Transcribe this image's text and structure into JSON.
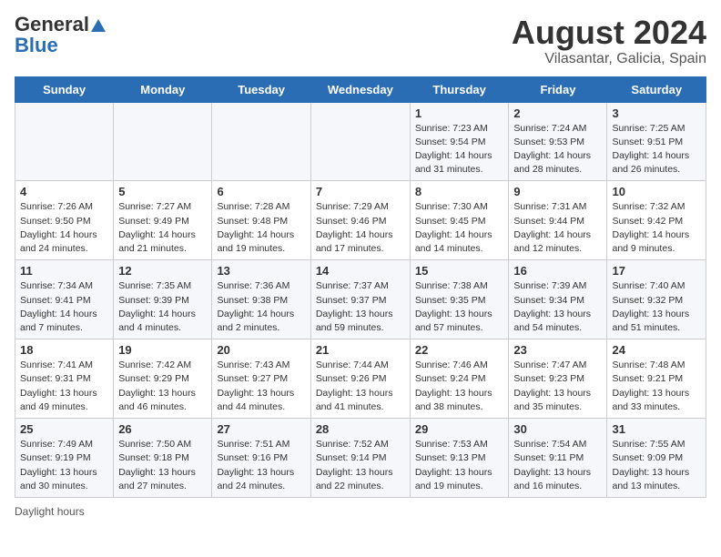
{
  "header": {
    "logo_general": "General",
    "logo_blue": "Blue",
    "title": "August 2024",
    "subtitle": "Vilasantar, Galicia, Spain"
  },
  "calendar": {
    "days_of_week": [
      "Sunday",
      "Monday",
      "Tuesday",
      "Wednesday",
      "Thursday",
      "Friday",
      "Saturday"
    ],
    "weeks": [
      [
        {
          "day": "",
          "detail": ""
        },
        {
          "day": "",
          "detail": ""
        },
        {
          "day": "",
          "detail": ""
        },
        {
          "day": "",
          "detail": ""
        },
        {
          "day": "1",
          "detail": "Sunrise: 7:23 AM\nSunset: 9:54 PM\nDaylight: 14 hours and 31 minutes."
        },
        {
          "day": "2",
          "detail": "Sunrise: 7:24 AM\nSunset: 9:53 PM\nDaylight: 14 hours and 28 minutes."
        },
        {
          "day": "3",
          "detail": "Sunrise: 7:25 AM\nSunset: 9:51 PM\nDaylight: 14 hours and 26 minutes."
        }
      ],
      [
        {
          "day": "4",
          "detail": "Sunrise: 7:26 AM\nSunset: 9:50 PM\nDaylight: 14 hours and 24 minutes."
        },
        {
          "day": "5",
          "detail": "Sunrise: 7:27 AM\nSunset: 9:49 PM\nDaylight: 14 hours and 21 minutes."
        },
        {
          "day": "6",
          "detail": "Sunrise: 7:28 AM\nSunset: 9:48 PM\nDaylight: 14 hours and 19 minutes."
        },
        {
          "day": "7",
          "detail": "Sunrise: 7:29 AM\nSunset: 9:46 PM\nDaylight: 14 hours and 17 minutes."
        },
        {
          "day": "8",
          "detail": "Sunrise: 7:30 AM\nSunset: 9:45 PM\nDaylight: 14 hours and 14 minutes."
        },
        {
          "day": "9",
          "detail": "Sunrise: 7:31 AM\nSunset: 9:44 PM\nDaylight: 14 hours and 12 minutes."
        },
        {
          "day": "10",
          "detail": "Sunrise: 7:32 AM\nSunset: 9:42 PM\nDaylight: 14 hours and 9 minutes."
        }
      ],
      [
        {
          "day": "11",
          "detail": "Sunrise: 7:34 AM\nSunset: 9:41 PM\nDaylight: 14 hours and 7 minutes."
        },
        {
          "day": "12",
          "detail": "Sunrise: 7:35 AM\nSunset: 9:39 PM\nDaylight: 14 hours and 4 minutes."
        },
        {
          "day": "13",
          "detail": "Sunrise: 7:36 AM\nSunset: 9:38 PM\nDaylight: 14 hours and 2 minutes."
        },
        {
          "day": "14",
          "detail": "Sunrise: 7:37 AM\nSunset: 9:37 PM\nDaylight: 13 hours and 59 minutes."
        },
        {
          "day": "15",
          "detail": "Sunrise: 7:38 AM\nSunset: 9:35 PM\nDaylight: 13 hours and 57 minutes."
        },
        {
          "day": "16",
          "detail": "Sunrise: 7:39 AM\nSunset: 9:34 PM\nDaylight: 13 hours and 54 minutes."
        },
        {
          "day": "17",
          "detail": "Sunrise: 7:40 AM\nSunset: 9:32 PM\nDaylight: 13 hours and 51 minutes."
        }
      ],
      [
        {
          "day": "18",
          "detail": "Sunrise: 7:41 AM\nSunset: 9:31 PM\nDaylight: 13 hours and 49 minutes."
        },
        {
          "day": "19",
          "detail": "Sunrise: 7:42 AM\nSunset: 9:29 PM\nDaylight: 13 hours and 46 minutes."
        },
        {
          "day": "20",
          "detail": "Sunrise: 7:43 AM\nSunset: 9:27 PM\nDaylight: 13 hours and 44 minutes."
        },
        {
          "day": "21",
          "detail": "Sunrise: 7:44 AM\nSunset: 9:26 PM\nDaylight: 13 hours and 41 minutes."
        },
        {
          "day": "22",
          "detail": "Sunrise: 7:46 AM\nSunset: 9:24 PM\nDaylight: 13 hours and 38 minutes."
        },
        {
          "day": "23",
          "detail": "Sunrise: 7:47 AM\nSunset: 9:23 PM\nDaylight: 13 hours and 35 minutes."
        },
        {
          "day": "24",
          "detail": "Sunrise: 7:48 AM\nSunset: 9:21 PM\nDaylight: 13 hours and 33 minutes."
        }
      ],
      [
        {
          "day": "25",
          "detail": "Sunrise: 7:49 AM\nSunset: 9:19 PM\nDaylight: 13 hours and 30 minutes."
        },
        {
          "day": "26",
          "detail": "Sunrise: 7:50 AM\nSunset: 9:18 PM\nDaylight: 13 hours and 27 minutes."
        },
        {
          "day": "27",
          "detail": "Sunrise: 7:51 AM\nSunset: 9:16 PM\nDaylight: 13 hours and 24 minutes."
        },
        {
          "day": "28",
          "detail": "Sunrise: 7:52 AM\nSunset: 9:14 PM\nDaylight: 13 hours and 22 minutes."
        },
        {
          "day": "29",
          "detail": "Sunrise: 7:53 AM\nSunset: 9:13 PM\nDaylight: 13 hours and 19 minutes."
        },
        {
          "day": "30",
          "detail": "Sunrise: 7:54 AM\nSunset: 9:11 PM\nDaylight: 13 hours and 16 minutes."
        },
        {
          "day": "31",
          "detail": "Sunrise: 7:55 AM\nSunset: 9:09 PM\nDaylight: 13 hours and 13 minutes."
        }
      ]
    ]
  },
  "footer": {
    "note": "Daylight hours"
  }
}
